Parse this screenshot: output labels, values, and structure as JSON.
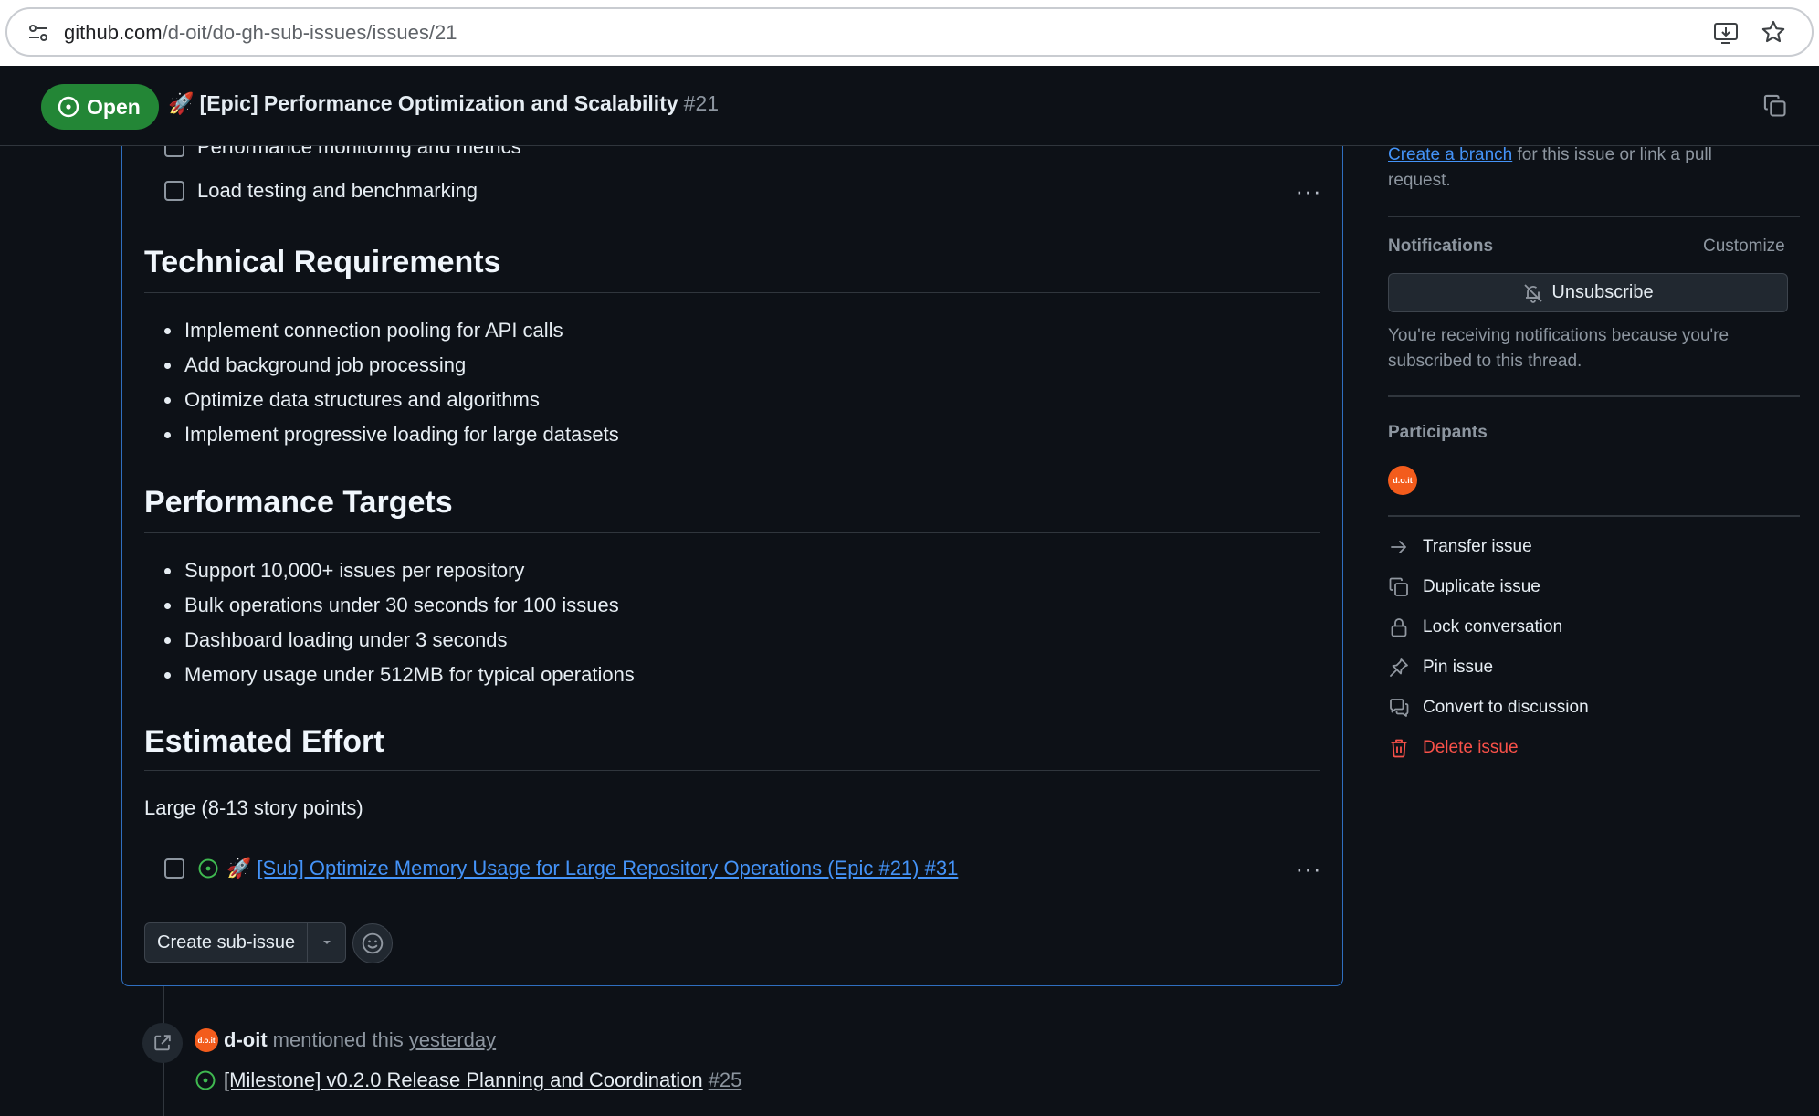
{
  "browser": {
    "url_host": "github.com",
    "url_path": "/d-oit/do-gh-sub-issues/issues/21"
  },
  "header": {
    "state": "Open",
    "emoji": "🚀",
    "title": "[Epic] Performance Optimization and Scalability",
    "number": "#21"
  },
  "tasks": [
    {
      "label": "Performance monitoring and metrics"
    },
    {
      "label": "Load testing and benchmarking"
    }
  ],
  "sections": {
    "technical": {
      "heading": "Technical Requirements",
      "items": [
        "Implement connection pooling for API calls",
        "Add background job processing",
        "Optimize data structures and algorithms",
        "Implement progressive loading for large datasets"
      ]
    },
    "performance": {
      "heading": "Performance Targets",
      "items": [
        "Support 10,000+ issues per repository",
        "Bulk operations under 30 seconds for 100 issues",
        "Dashboard loading under 3 seconds",
        "Memory usage under 512MB for typical operations"
      ]
    },
    "effort": {
      "heading": "Estimated Effort",
      "text": "Large (8-13 story points)"
    }
  },
  "sub_issue": {
    "emoji": "🚀",
    "title": "[Sub] Optimize Memory Usage for Large Repository Operations (Epic #21) #31"
  },
  "actions_bar": {
    "create_label": "Create sub-issue"
  },
  "timeline": {
    "actor": "d-oit",
    "text": "mentioned this",
    "time": "yesterday",
    "ref_title": "[Milestone] v0.2.0 Release Planning and Coordination",
    "ref_number": "#25",
    "avatar_text": "d.o.it"
  },
  "sidebar": {
    "development": {
      "link": "Create a branch",
      "text1": " for this issue or link a pull",
      "text2": "request."
    },
    "notifications": {
      "heading": "Notifications",
      "customize": "Customize",
      "button": "Unsubscribe",
      "note1": "You're receiving notifications because you're",
      "note2": "subscribed to this thread."
    },
    "participants": {
      "heading": "Participants",
      "avatar_text": "d.o.it"
    },
    "actions": [
      {
        "label": "Transfer issue",
        "icon": "arrow-right-icon"
      },
      {
        "label": "Duplicate issue",
        "icon": "duplicate-icon"
      },
      {
        "label": "Lock conversation",
        "icon": "lock-icon"
      },
      {
        "label": "Pin issue",
        "icon": "pin-icon"
      },
      {
        "label": "Convert to discussion",
        "icon": "discussion-icon"
      },
      {
        "label": "Delete issue",
        "icon": "trash-icon"
      }
    ]
  },
  "colors": {
    "open_green": "#238636",
    "link_blue": "#4493f8",
    "danger_red": "#f85149",
    "avatar_orange": "#f35c1c"
  }
}
